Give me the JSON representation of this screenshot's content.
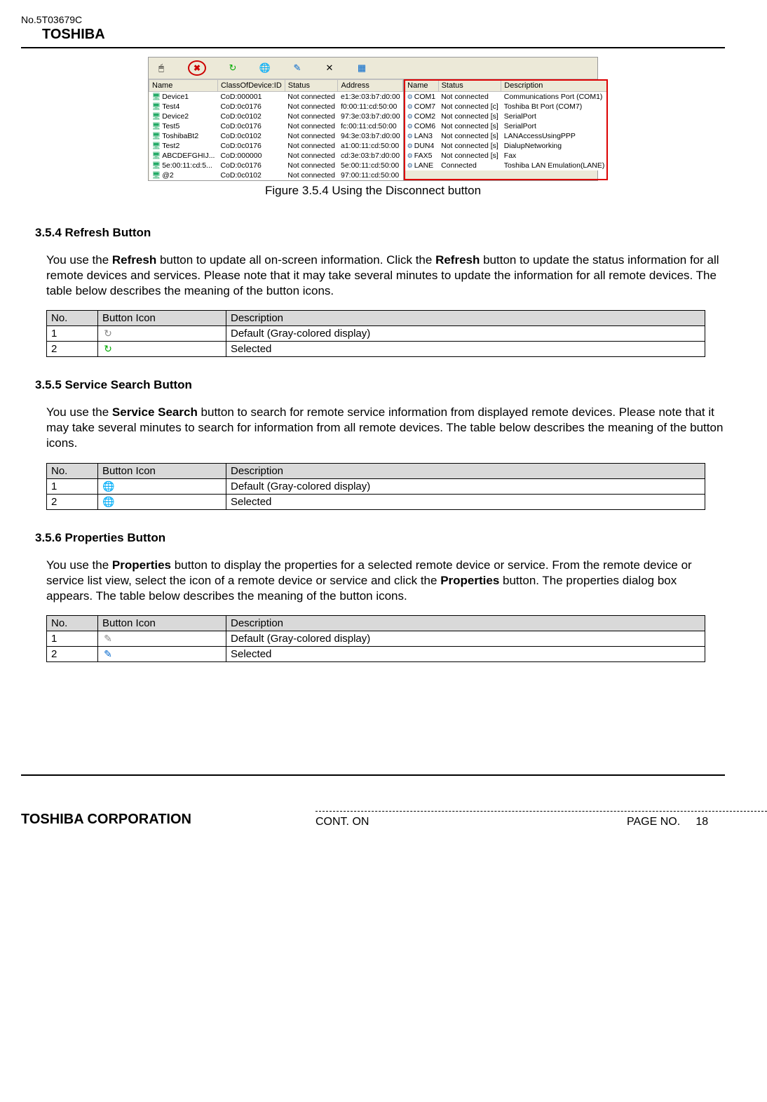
{
  "header": {
    "doc_no": "No.5T03679C",
    "brand": "TOSHIBA"
  },
  "screenshot": {
    "left_headers": [
      "Name",
      "ClassOfDevice:ID",
      "Status",
      "Address"
    ],
    "left_rows": [
      {
        "name": "Device1",
        "cod": "CoD:000001",
        "status": "Not connected",
        "addr": "e1:3e:03:b7:d0:00"
      },
      {
        "name": "Test4",
        "cod": "CoD:0c0176",
        "status": "Not connected",
        "addr": "f0:00:11:cd:50:00"
      },
      {
        "name": "Device2",
        "cod": "CoD:0c0102",
        "status": "Not connected",
        "addr": "97:3e:03:b7:d0:00"
      },
      {
        "name": "Test5",
        "cod": "CoD:0c0176",
        "status": "Not connected",
        "addr": "fc:00:11:cd:50:00"
      },
      {
        "name": "ToshibaBt2",
        "cod": "CoD:0c0102",
        "status": "Not connected",
        "addr": "94:3e:03:b7:d0:00"
      },
      {
        "name": "Test2",
        "cod": "CoD:0c0176",
        "status": "Not connected",
        "addr": "a1:00:11:cd:50:00"
      },
      {
        "name": "ABCDEFGHIJ...",
        "cod": "CoD:000000",
        "status": "Not connected",
        "addr": "cd:3e:03:b7:d0:00"
      },
      {
        "name": "5e:00:11:cd:5...",
        "cod": "CoD:0c0176",
        "status": "Not connected",
        "addr": "5e:00:11:cd:50:00"
      },
      {
        "name": "@2",
        "cod": "CoD:0c0102",
        "status": "Not connected",
        "addr": "97:00:11:cd:50:00"
      }
    ],
    "right_headers": [
      "Name",
      "Status",
      "Description"
    ],
    "right_rows": [
      {
        "name": "COM1",
        "status": "Not connected",
        "desc": "Communications Port (COM1)"
      },
      {
        "name": "COM7",
        "status": "Not connected [c]",
        "desc": "Toshiba Bt Port (COM7)"
      },
      {
        "name": "COM2",
        "status": "Not connected [s]",
        "desc": "SerialPort"
      },
      {
        "name": "COM6",
        "status": "Not connected [s]",
        "desc": "SerialPort"
      },
      {
        "name": "LAN3",
        "status": "Not connected [s]",
        "desc": "LANAccessUsingPPP"
      },
      {
        "name": "DUN4",
        "status": "Not connected [s]",
        "desc": "DialupNetworking"
      },
      {
        "name": "FAX5",
        "status": "Not connected [s]",
        "desc": "Fax"
      },
      {
        "name": "LANE",
        "status": "Connected",
        "desc": "Toshiba LAN Emulation(LANE)"
      }
    ]
  },
  "figure_caption": "Figure 3.5.4 Using the Disconnect button",
  "sections": {
    "refresh": {
      "title": "3.5.4 Refresh Button",
      "body_pre": "You use the ",
      "body_bold1": "Refresh",
      "body_mid1": " button to update all on-screen information. Click the ",
      "body_bold2": "Refresh",
      "body_post": " button to update the status information for all remote devices and services. Please note that it may take several minutes to update the information for all remote devices. The table below describes the meaning of the button icons.",
      "table": {
        "headers": {
          "no": "No.",
          "icon": "Button Icon",
          "desc": "Description"
        },
        "rows": [
          {
            "no": "1",
            "icon_class": "ic-refresh-gray",
            "icon_glyph": "↻",
            "desc": "Default (Gray-colored display)"
          },
          {
            "no": "2",
            "icon_class": "ic-refresh-sel",
            "icon_glyph": "↻",
            "desc": "Selected"
          }
        ]
      }
    },
    "service": {
      "title": "3.5.5 Service Search Button",
      "body_pre": "You use the ",
      "body_bold1": "Service Search",
      "body_post": " button to search for remote service information from displayed remote devices. Please note that it may take several minutes to search for information from all remote devices. The table below describes the meaning of the button icons.",
      "table": {
        "headers": {
          "no": "No.",
          "icon": "Button Icon",
          "desc": "Description"
        },
        "rows": [
          {
            "no": "1",
            "icon_class": "ic-globe-gray",
            "icon_glyph": "🌐",
            "desc": "Default (Gray-colored display)"
          },
          {
            "no": "2",
            "icon_class": "ic-globe-sel",
            "icon_glyph": "🌐",
            "desc": "Selected"
          }
        ]
      }
    },
    "properties": {
      "title": "3.5.6 Properties Button",
      "body_pre": "You use the ",
      "body_bold1": "Properties",
      "body_mid1": " button to display the properties for a selected remote device or service. From the remote device or service list view, select the icon of a remote device or service and click the ",
      "body_bold2": "Properties",
      "body_post": " button. The properties dialog box appears. The table below describes the meaning of the button icons.",
      "table": {
        "headers": {
          "no": "No.",
          "icon": "Button Icon",
          "desc": "Description"
        },
        "rows": [
          {
            "no": "1",
            "icon_class": "ic-prop-gray",
            "icon_glyph": "✎",
            "desc": "Default (Gray-colored display)"
          },
          {
            "no": "2",
            "icon_class": "ic-prop-sel",
            "icon_glyph": "✎",
            "desc": "Selected"
          }
        ]
      }
    }
  },
  "footer": {
    "corp": "TOSHIBA CORPORATION",
    "cont_on": "CONT. ON",
    "page_no_label": "PAGE NO.",
    "page_no": "18"
  }
}
